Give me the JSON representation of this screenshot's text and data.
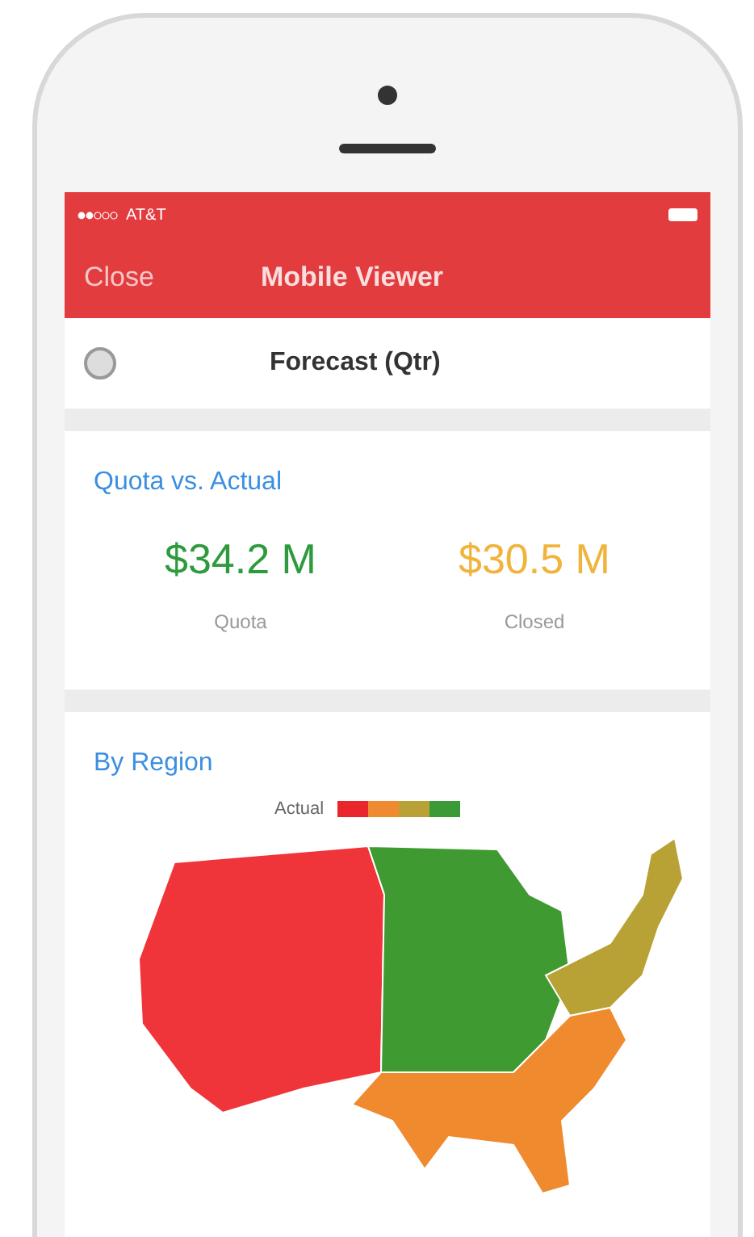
{
  "status_bar": {
    "carrier": "AT&T"
  },
  "nav_bar": {
    "close": "Close",
    "title": "Mobile Viewer"
  },
  "header": {
    "title": "Forecast (Qtr)"
  },
  "quota_card": {
    "title": "Quota vs. Actual",
    "metrics": [
      {
        "value": "$34.2 M",
        "label": "Quota",
        "color": "#2e9a3e"
      },
      {
        "value": "$30.5 M",
        "label": "Closed",
        "color": "#f0b43c"
      }
    ]
  },
  "region_card": {
    "title": "By Region",
    "legend_label": "Actual",
    "legend": [
      {
        "color": "#e8262b"
      },
      {
        "color": "#f08a2e"
      },
      {
        "color": "#b8a235"
      },
      {
        "color": "#3a9a36"
      }
    ],
    "regions": [
      {
        "color": "#f0353a"
      },
      {
        "color": "#3f9a31"
      },
      {
        "color": "#b8a235"
      },
      {
        "color": "#f08a2e"
      }
    ]
  }
}
